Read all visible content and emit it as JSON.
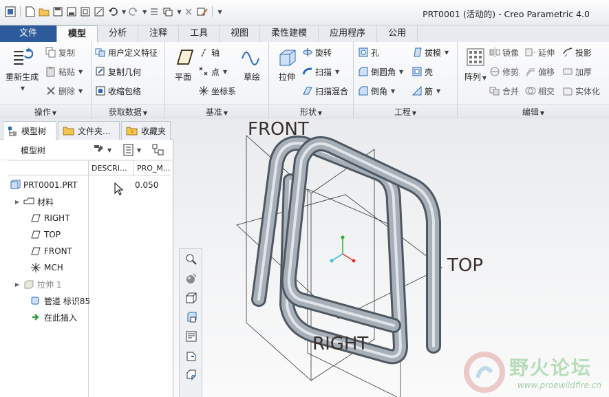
{
  "window": {
    "title": "PRT0001 (活动的) - Creo Parametric 4.0"
  },
  "ribbon_tabs": [
    "文件",
    "模型",
    "分析",
    "注释",
    "工具",
    "视图",
    "柔性建模",
    "应用程序",
    "公用"
  ],
  "groups": {
    "operations": {
      "footer": "操作",
      "regen": "重新生成",
      "copy": "复制",
      "paste": "粘贴",
      "delete": "删除"
    },
    "get_data": {
      "footer": "获取数据",
      "udf": "用户定义特征",
      "copy_geom": "复制几何",
      "shrinkwrap": "收缩包络"
    },
    "datum": {
      "footer": "基准",
      "plane": "平面",
      "axis": "轴",
      "point": "点",
      "csys": "坐标系",
      "sketch": "草绘"
    },
    "shapes": {
      "footer": "形状",
      "extrude": "拉伸",
      "revolve": "旋转",
      "sweep": "扫描",
      "swept_blend": "扫描混合"
    },
    "engineering": {
      "footer": "工程",
      "hole": "孔",
      "round": "倒圆角",
      "chamfer": "倒角",
      "draft": "拔模",
      "shell": "壳",
      "rib": "筋"
    },
    "editing": {
      "footer": "编辑",
      "pattern": "阵列",
      "mirror": "镜像",
      "trim": "修剪",
      "merge": "合并",
      "extend": "延伸",
      "offset": "偏移",
      "intersect": "相交",
      "project": "投影",
      "thicken": "加厚",
      "solidify": "实体化"
    }
  },
  "panel": {
    "tabs": [
      "模型树",
      "文件夹...",
      "收藏夹"
    ],
    "toolbar_title": "模型树",
    "columns": [
      "DESCRI...",
      "PRO_M..."
    ],
    "rows": [
      {
        "label": "PRT0001.PRT",
        "value": "0.050"
      },
      {
        "label": "材料",
        "value": ""
      },
      {
        "label": "RIGHT",
        "value": ""
      },
      {
        "label": "TOP",
        "value": ""
      },
      {
        "label": "FRONT",
        "value": ""
      },
      {
        "label": "MCH",
        "value": ""
      },
      {
        "label": "拉伸 1",
        "value": ""
      },
      {
        "label": "管道 标识85",
        "value": ""
      },
      {
        "label": "在此插入",
        "value": ""
      }
    ]
  },
  "viewport": {
    "plane_labels": {
      "front": "FRONT",
      "top": "TOP",
      "right": "RIGHT"
    }
  },
  "watermark": {
    "text": "野火论坛",
    "url": "www.proewildfire.cn"
  },
  "colors": {
    "file_tab": "#2b5b9a",
    "pipe": "#9aa3ad",
    "axis_x": "#e03030",
    "axis_y": "#30b030",
    "axis_z": "#3060e0"
  }
}
